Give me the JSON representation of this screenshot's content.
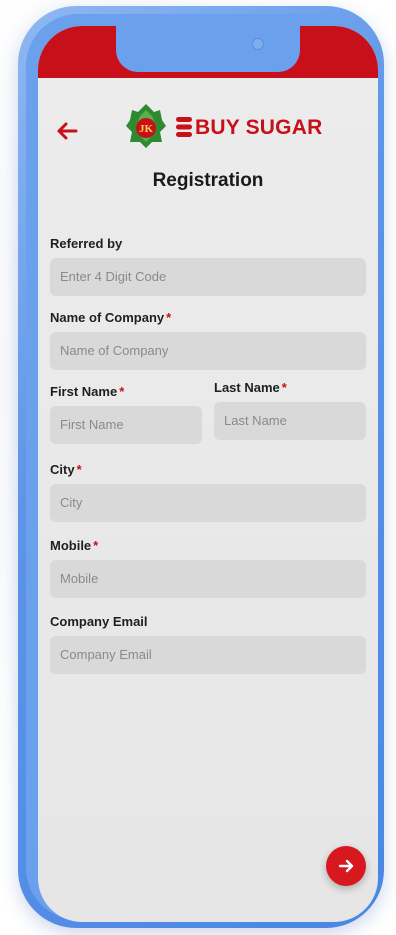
{
  "header": {
    "back_icon": "arrow-left-icon",
    "logo_mark": "JK",
    "brand_name": "BUY SUGAR",
    "page_title": "Registration"
  },
  "form": {
    "referred_by": {
      "label": "Referred by",
      "placeholder": "Enter 4 Digit Code",
      "required": false
    },
    "company_name": {
      "label": "Name of Company",
      "placeholder": "Name of Company",
      "required": true
    },
    "first_name": {
      "label": "First Name",
      "placeholder": "First Name",
      "required": true
    },
    "last_name": {
      "label": "Last Name",
      "placeholder": "Last Name",
      "required": true
    },
    "city": {
      "label": "City",
      "placeholder": "City",
      "required": true
    },
    "mobile": {
      "label": "Mobile",
      "placeholder": "Mobile",
      "required": true
    },
    "company_email": {
      "label": "Company Email",
      "placeholder": "Company Email",
      "required": false
    },
    "required_marker": "*"
  },
  "actions": {
    "next_icon": "arrow-right-icon"
  },
  "colors": {
    "brand_red": "#c8101a",
    "screen_bg": "#ececec",
    "field_bg": "#d9d9d9",
    "frame_blue": "#4a86e4"
  }
}
